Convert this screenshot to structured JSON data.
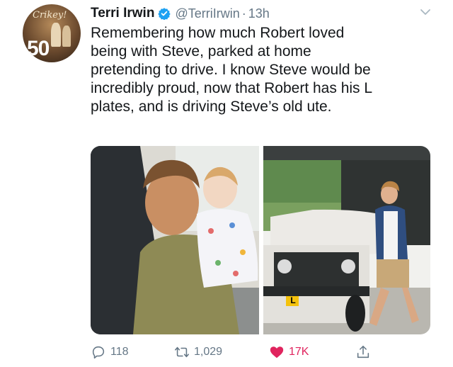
{
  "user": {
    "name": "Terri Irwin",
    "handle": "@TerriIrwin",
    "separator": "·",
    "time": "13h",
    "avatar_text_top": "Crikey!",
    "avatar_text_number": "50"
  },
  "tweet": {
    "text": "Remembering how much Robert loved\nbeing with Steve, parked at home\npretending to drive. I know Steve would be\nincredibly proud, now that Robert has his L\nplates, and is driving Steve’s old ute."
  },
  "media": {
    "plate_letter": "L"
  },
  "actions": {
    "replies": "118",
    "retweets": "1,029",
    "likes": "17K",
    "like_color": "#e0245e"
  },
  "icons": {
    "verified": "verified-badge-icon",
    "menu": "chevron-down-icon",
    "reply": "reply-icon",
    "retweet": "retweet-icon",
    "like": "heart-icon",
    "share": "share-icon"
  },
  "colors": {
    "text": "#14171a",
    "secondary": "#657786",
    "verified": "#1da1f2"
  }
}
